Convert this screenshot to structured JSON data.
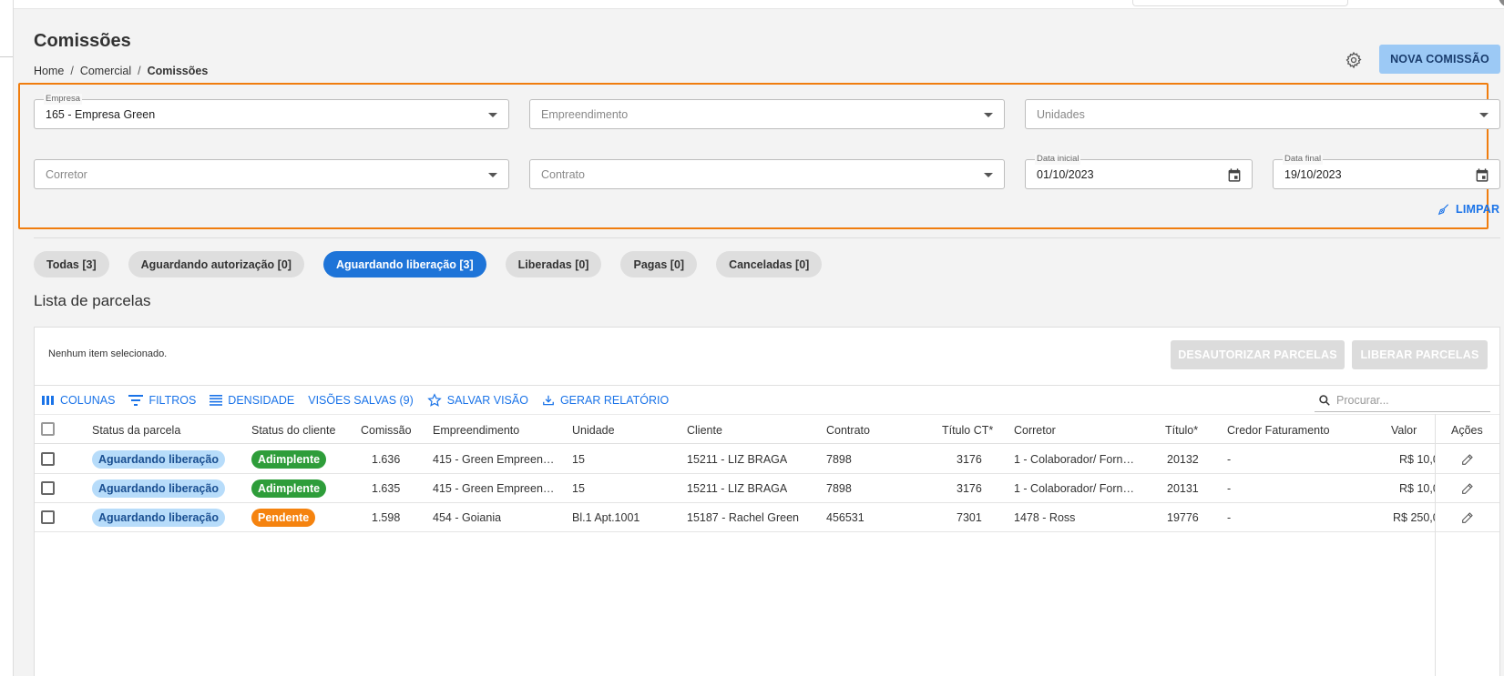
{
  "header": {
    "title": "Comissões",
    "breadcrumb": [
      "Home",
      "Comercial",
      "Comissões"
    ],
    "new_button": "NOVA COMISSÃO"
  },
  "filters": {
    "empresa": {
      "label": "Empresa",
      "value": "165 - Empresa Green"
    },
    "empreendimento": {
      "placeholder": "Empreendimento"
    },
    "unidades": {
      "placeholder": "Unidades"
    },
    "corretor": {
      "placeholder": "Corretor"
    },
    "contrato": {
      "placeholder": "Contrato"
    },
    "data_inicial": {
      "label": "Data inicial",
      "value": "01/10/2023"
    },
    "data_final": {
      "label": "Data final",
      "value": "19/10/2023"
    },
    "clear": "LIMPAR"
  },
  "chips": [
    {
      "label": "Todas [3]",
      "active": false
    },
    {
      "label": "Aguardando autorização [0]",
      "active": false
    },
    {
      "label": "Aguardando liberação [3]",
      "active": true
    },
    {
      "label": "Liberadas [0]",
      "active": false
    },
    {
      "label": "Pagas [0]",
      "active": false
    },
    {
      "label": "Canceladas [0]",
      "active": false
    }
  ],
  "list": {
    "title": "Lista de parcelas",
    "selection_info": "Nenhum item selecionado.",
    "deauthorize_button": "DESAUTORIZAR PARCELAS",
    "release_button": "LIBERAR PARCELAS",
    "toolbar": {
      "columns": "COLUNAS",
      "filters": "FILTROS",
      "density": "DENSIDADE",
      "saved_views": "VISÕES SALVAS (9)",
      "save_view": "SALVAR VISÃO",
      "report": "GERAR RELATÓRIO",
      "search_placeholder": "Procurar..."
    },
    "columns": [
      "Status da parcela",
      "Status do cliente",
      "Comissão",
      "Empreendimento",
      "Unidade",
      "Cliente",
      "Contrato",
      "Título CT*",
      "Corretor",
      "Título*",
      "Credor Faturamento",
      "Valor",
      "Ações"
    ],
    "rows": [
      {
        "status_parcela": "Aguardando liberação",
        "status_cliente": "Adimplente",
        "comissao": "1.636",
        "empreendimento": "415 - Green Empreen…",
        "unidade": "15",
        "cliente": "15211 - LIZ BRAGA",
        "contrato": "7898",
        "titulo_ct": "3176",
        "corretor": "1 - Colaborador/ Forn…",
        "titulo": "20132",
        "credor": "-",
        "valor": "R$ 10,0"
      },
      {
        "status_parcela": "Aguardando liberação",
        "status_cliente": "Adimplente",
        "comissao": "1.635",
        "empreendimento": "415 - Green Empreen…",
        "unidade": "15",
        "cliente": "15211 - LIZ BRAGA",
        "contrato": "7898",
        "titulo_ct": "3176",
        "corretor": "1 - Colaborador/ Forn…",
        "titulo": "20131",
        "credor": "-",
        "valor": "R$ 10,0"
      },
      {
        "status_parcela": "Aguardando liberação",
        "status_cliente": "Pendente",
        "comissao": "1.598",
        "empreendimento": "454 - Goiania",
        "unidade": "Bl.1 Apt.1001",
        "cliente": "15187 - Rachel Green",
        "contrato": "456531",
        "titulo_ct": "7301",
        "corretor": "1478 - Ross",
        "titulo": "19776",
        "credor": "-",
        "valor": "R$ 250,0"
      }
    ]
  },
  "colors": {
    "accent": "#1e74d8",
    "highlight_border": "#f07d0e",
    "adimplente": "#2e9d3a",
    "pendente": "#f5830f"
  }
}
